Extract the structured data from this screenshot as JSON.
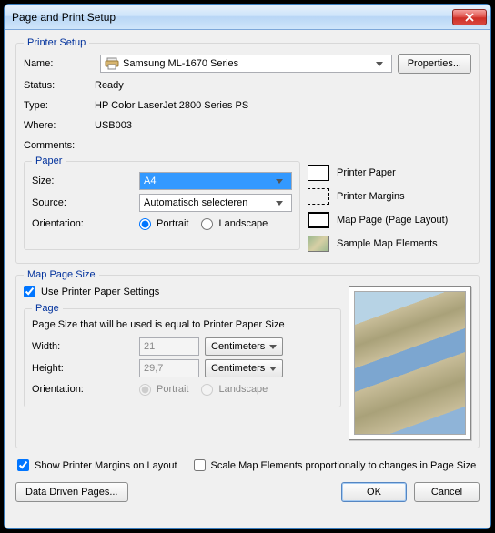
{
  "window": {
    "title": "Page and Print Setup"
  },
  "printerSetup": {
    "legend": "Printer Setup",
    "nameLabel": "Name:",
    "printerName": "Samsung ML-1670 Series",
    "propertiesBtn": "Properties...",
    "statusLabel": "Status:",
    "statusValue": "Ready",
    "typeLabel": "Type:",
    "typeValue": "HP Color LaserJet 2800 Series PS",
    "whereLabel": "Where:",
    "whereValue": "USB003",
    "commentsLabel": "Comments:"
  },
  "paper": {
    "legend": "Paper",
    "sizeLabel": "Size:",
    "sizeValue": "A4",
    "sourceLabel": "Source:",
    "sourceValue": "Automatisch selecteren",
    "orientLabel": "Orientation:",
    "portrait": "Portrait",
    "landscape": "Landscape"
  },
  "legendItems": {
    "printerPaper": "Printer Paper",
    "printerMargins": "Printer Margins",
    "mapPage": "Map Page (Page Layout)",
    "sample": "Sample Map Elements"
  },
  "mapPageSize": {
    "legend": "Map Page Size",
    "usePrinter": "Use Printer Paper Settings",
    "pageLegend": "Page",
    "note": "Page Size that will be used is equal to Printer Paper Size",
    "widthLabel": "Width:",
    "widthValue": "21",
    "heightLabel": "Height:",
    "heightValue": "29,7",
    "unit": "Centimeters",
    "orientLabel": "Orientation:",
    "portrait": "Portrait",
    "landscape": "Landscape"
  },
  "bottom": {
    "showMargins": "Show Printer Margins on Layout",
    "scaleElements": "Scale Map Elements proportionally to changes in Page Size"
  },
  "buttons": {
    "ddp": "Data Driven Pages...",
    "ok": "OK",
    "cancel": "Cancel"
  }
}
